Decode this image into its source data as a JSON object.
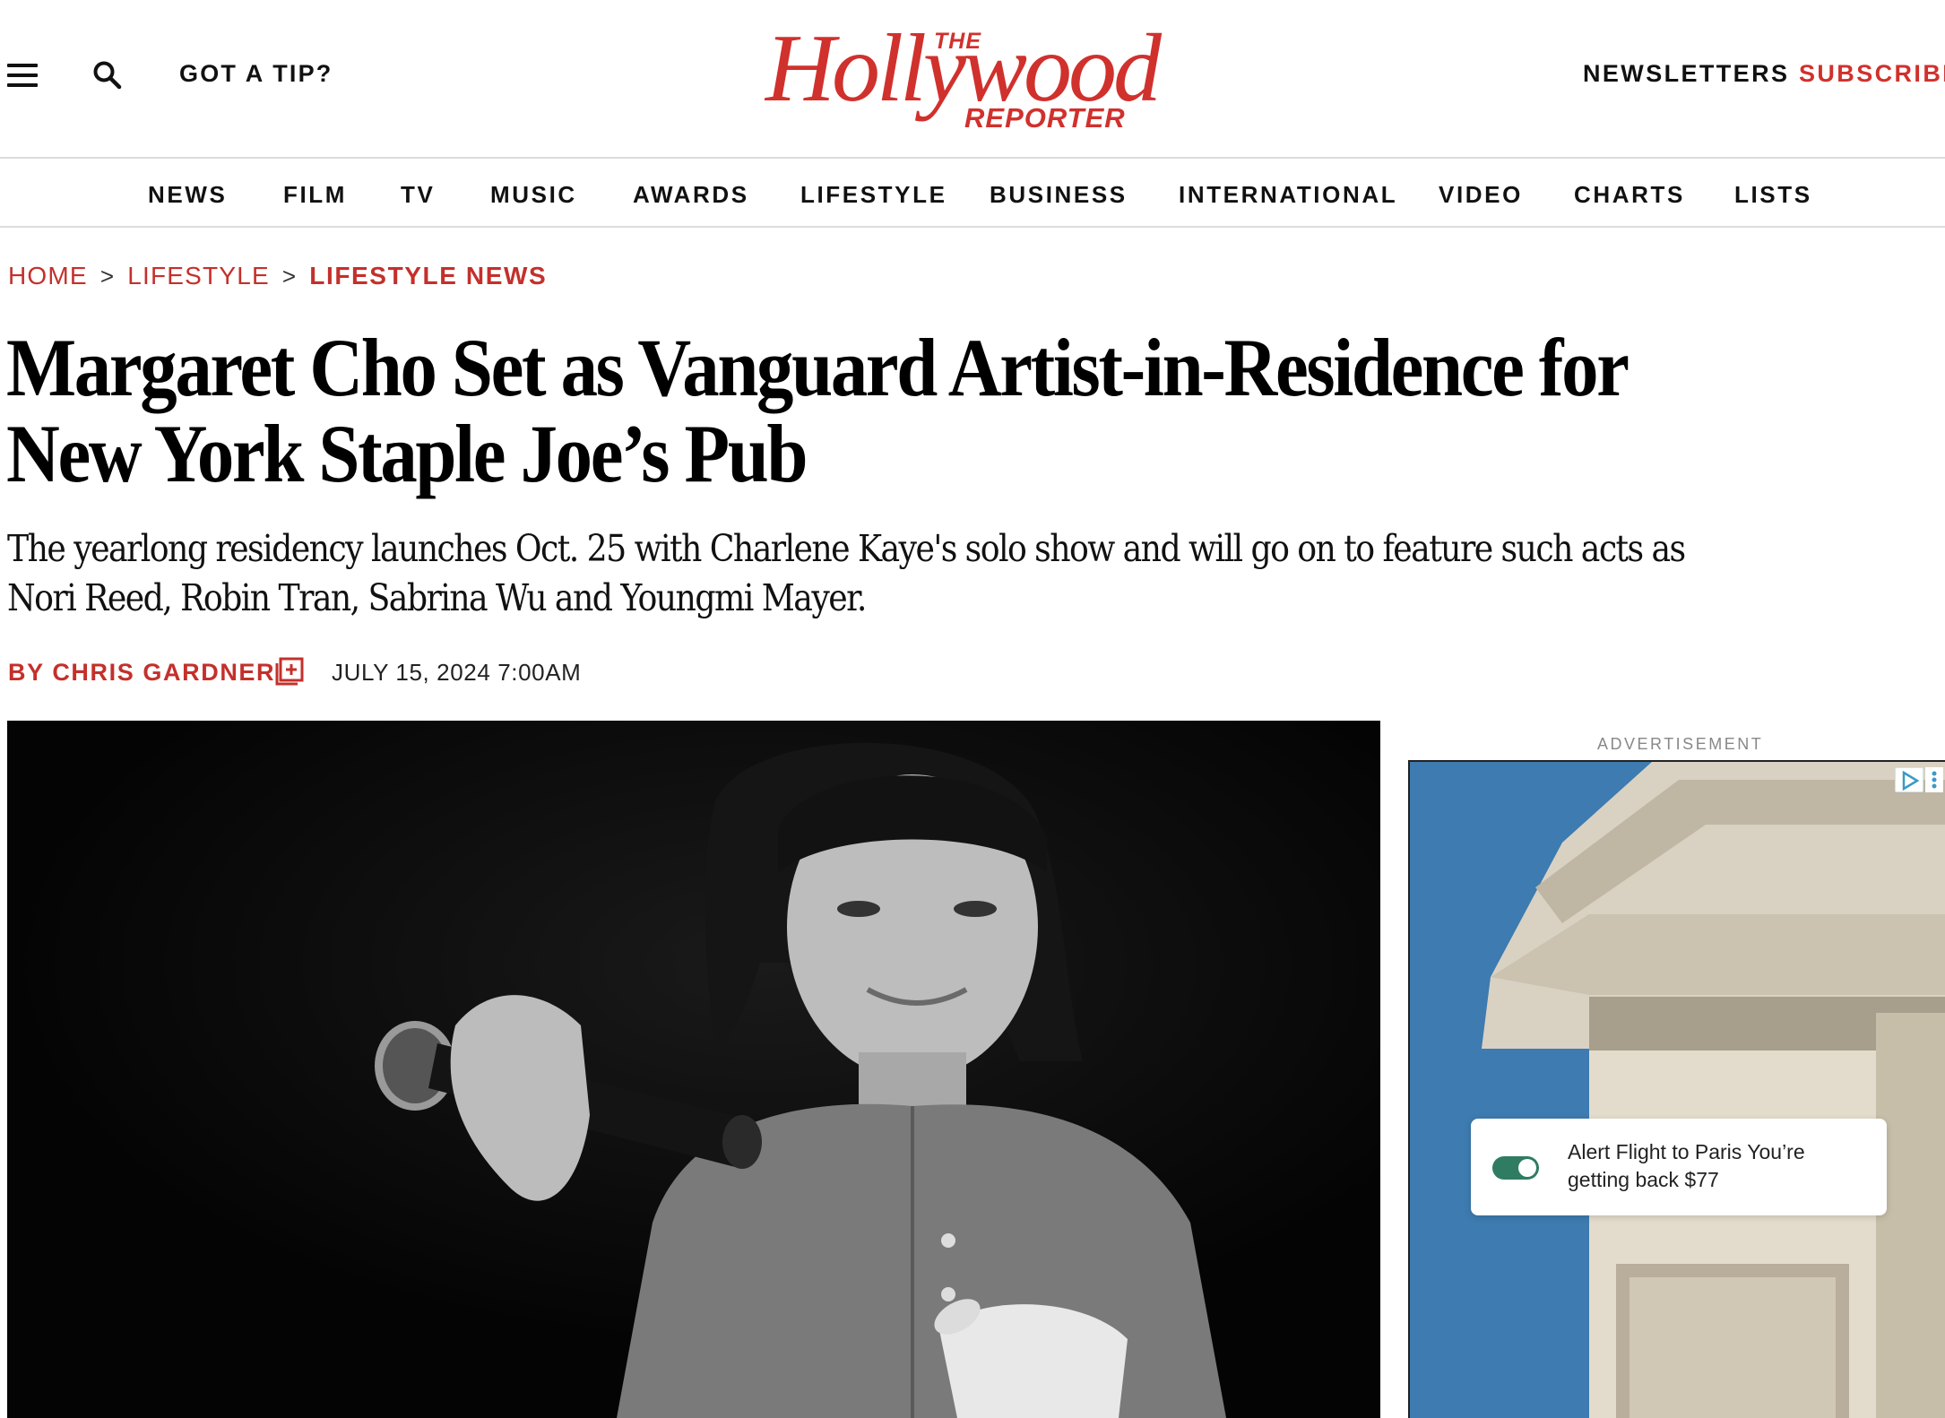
{
  "header": {
    "tip_label": "GOT A TIP?",
    "logo_text": "The Hollywood Reporter",
    "newsletters_label": "NEWSLETTERS",
    "subscribe_label": "SUBSCRIBE"
  },
  "nav": {
    "items": [
      {
        "label": "NEWS"
      },
      {
        "label": "FILM"
      },
      {
        "label": "TV"
      },
      {
        "label": "MUSIC"
      },
      {
        "label": "AWARDS"
      },
      {
        "label": "LIFESTYLE"
      },
      {
        "label": "BUSINESS"
      },
      {
        "label": "INTERNATIONAL"
      },
      {
        "label": "VIDEO"
      },
      {
        "label": "CHARTS"
      },
      {
        "label": "LISTS"
      }
    ]
  },
  "breadcrumb": {
    "items": [
      "HOME",
      "LIFESTYLE",
      "LIFESTYLE NEWS"
    ],
    "separator": ">"
  },
  "article": {
    "title": "Margaret Cho Set as Vanguard Artist-in-Residence for New York Staple Joe’s Pub",
    "dek": "The yearlong residency launches Oct. 25 with Charlene Kaye's solo show and will go on to feature such acts as Nori Reed, Robin Tran, Sabrina Wu and Youngmi Mayer.",
    "byline": "BY CHRIS GARDNER",
    "date": "JULY 15, 2024 7:00AM"
  },
  "ad": {
    "label": "ADVERTISEMENT",
    "card_text": "Alert Flight to Paris You’re getting back $77"
  },
  "colors": {
    "brand_red": "#d0312d",
    "breadcrumb_red": "#c4302b",
    "ad_toggle_green": "#2f7c62",
    "ad_sky": "#3d7bb0"
  }
}
